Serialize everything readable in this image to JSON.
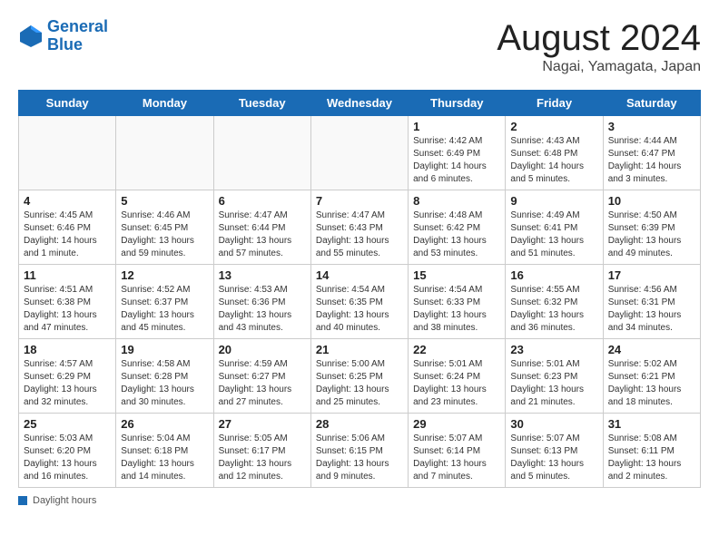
{
  "header": {
    "logo_line1": "General",
    "logo_line2": "Blue",
    "month": "August 2024",
    "location": "Nagai, Yamagata, Japan"
  },
  "weekdays": [
    "Sunday",
    "Monday",
    "Tuesday",
    "Wednesday",
    "Thursday",
    "Friday",
    "Saturday"
  ],
  "footer_label": "Daylight hours",
  "weeks": [
    [
      {
        "day": "",
        "sunrise": "",
        "sunset": "",
        "daylight": "",
        "empty": true
      },
      {
        "day": "",
        "sunrise": "",
        "sunset": "",
        "daylight": "",
        "empty": true
      },
      {
        "day": "",
        "sunrise": "",
        "sunset": "",
        "daylight": "",
        "empty": true
      },
      {
        "day": "",
        "sunrise": "",
        "sunset": "",
        "daylight": "",
        "empty": true
      },
      {
        "day": "1",
        "sunrise": "Sunrise: 4:42 AM",
        "sunset": "Sunset: 6:49 PM",
        "daylight": "Daylight: 14 hours and 6 minutes."
      },
      {
        "day": "2",
        "sunrise": "Sunrise: 4:43 AM",
        "sunset": "Sunset: 6:48 PM",
        "daylight": "Daylight: 14 hours and 5 minutes."
      },
      {
        "day": "3",
        "sunrise": "Sunrise: 4:44 AM",
        "sunset": "Sunset: 6:47 PM",
        "daylight": "Daylight: 14 hours and 3 minutes."
      }
    ],
    [
      {
        "day": "4",
        "sunrise": "Sunrise: 4:45 AM",
        "sunset": "Sunset: 6:46 PM",
        "daylight": "Daylight: 14 hours and 1 minute."
      },
      {
        "day": "5",
        "sunrise": "Sunrise: 4:46 AM",
        "sunset": "Sunset: 6:45 PM",
        "daylight": "Daylight: 13 hours and 59 minutes."
      },
      {
        "day": "6",
        "sunrise": "Sunrise: 4:47 AM",
        "sunset": "Sunset: 6:44 PM",
        "daylight": "Daylight: 13 hours and 57 minutes."
      },
      {
        "day": "7",
        "sunrise": "Sunrise: 4:47 AM",
        "sunset": "Sunset: 6:43 PM",
        "daylight": "Daylight: 13 hours and 55 minutes."
      },
      {
        "day": "8",
        "sunrise": "Sunrise: 4:48 AM",
        "sunset": "Sunset: 6:42 PM",
        "daylight": "Daylight: 13 hours and 53 minutes."
      },
      {
        "day": "9",
        "sunrise": "Sunrise: 4:49 AM",
        "sunset": "Sunset: 6:41 PM",
        "daylight": "Daylight: 13 hours and 51 minutes."
      },
      {
        "day": "10",
        "sunrise": "Sunrise: 4:50 AM",
        "sunset": "Sunset: 6:39 PM",
        "daylight": "Daylight: 13 hours and 49 minutes."
      }
    ],
    [
      {
        "day": "11",
        "sunrise": "Sunrise: 4:51 AM",
        "sunset": "Sunset: 6:38 PM",
        "daylight": "Daylight: 13 hours and 47 minutes."
      },
      {
        "day": "12",
        "sunrise": "Sunrise: 4:52 AM",
        "sunset": "Sunset: 6:37 PM",
        "daylight": "Daylight: 13 hours and 45 minutes."
      },
      {
        "day": "13",
        "sunrise": "Sunrise: 4:53 AM",
        "sunset": "Sunset: 6:36 PM",
        "daylight": "Daylight: 13 hours and 43 minutes."
      },
      {
        "day": "14",
        "sunrise": "Sunrise: 4:54 AM",
        "sunset": "Sunset: 6:35 PM",
        "daylight": "Daylight: 13 hours and 40 minutes."
      },
      {
        "day": "15",
        "sunrise": "Sunrise: 4:54 AM",
        "sunset": "Sunset: 6:33 PM",
        "daylight": "Daylight: 13 hours and 38 minutes."
      },
      {
        "day": "16",
        "sunrise": "Sunrise: 4:55 AM",
        "sunset": "Sunset: 6:32 PM",
        "daylight": "Daylight: 13 hours and 36 minutes."
      },
      {
        "day": "17",
        "sunrise": "Sunrise: 4:56 AM",
        "sunset": "Sunset: 6:31 PM",
        "daylight": "Daylight: 13 hours and 34 minutes."
      }
    ],
    [
      {
        "day": "18",
        "sunrise": "Sunrise: 4:57 AM",
        "sunset": "Sunset: 6:29 PM",
        "daylight": "Daylight: 13 hours and 32 minutes."
      },
      {
        "day": "19",
        "sunrise": "Sunrise: 4:58 AM",
        "sunset": "Sunset: 6:28 PM",
        "daylight": "Daylight: 13 hours and 30 minutes."
      },
      {
        "day": "20",
        "sunrise": "Sunrise: 4:59 AM",
        "sunset": "Sunset: 6:27 PM",
        "daylight": "Daylight: 13 hours and 27 minutes."
      },
      {
        "day": "21",
        "sunrise": "Sunrise: 5:00 AM",
        "sunset": "Sunset: 6:25 PM",
        "daylight": "Daylight: 13 hours and 25 minutes."
      },
      {
        "day": "22",
        "sunrise": "Sunrise: 5:01 AM",
        "sunset": "Sunset: 6:24 PM",
        "daylight": "Daylight: 13 hours and 23 minutes."
      },
      {
        "day": "23",
        "sunrise": "Sunrise: 5:01 AM",
        "sunset": "Sunset: 6:23 PM",
        "daylight": "Daylight: 13 hours and 21 minutes."
      },
      {
        "day": "24",
        "sunrise": "Sunrise: 5:02 AM",
        "sunset": "Sunset: 6:21 PM",
        "daylight": "Daylight: 13 hours and 18 minutes."
      }
    ],
    [
      {
        "day": "25",
        "sunrise": "Sunrise: 5:03 AM",
        "sunset": "Sunset: 6:20 PM",
        "daylight": "Daylight: 13 hours and 16 minutes."
      },
      {
        "day": "26",
        "sunrise": "Sunrise: 5:04 AM",
        "sunset": "Sunset: 6:18 PM",
        "daylight": "Daylight: 13 hours and 14 minutes."
      },
      {
        "day": "27",
        "sunrise": "Sunrise: 5:05 AM",
        "sunset": "Sunset: 6:17 PM",
        "daylight": "Daylight: 13 hours and 12 minutes."
      },
      {
        "day": "28",
        "sunrise": "Sunrise: 5:06 AM",
        "sunset": "Sunset: 6:15 PM",
        "daylight": "Daylight: 13 hours and 9 minutes."
      },
      {
        "day": "29",
        "sunrise": "Sunrise: 5:07 AM",
        "sunset": "Sunset: 6:14 PM",
        "daylight": "Daylight: 13 hours and 7 minutes."
      },
      {
        "day": "30",
        "sunrise": "Sunrise: 5:07 AM",
        "sunset": "Sunset: 6:13 PM",
        "daylight": "Daylight: 13 hours and 5 minutes."
      },
      {
        "day": "31",
        "sunrise": "Sunrise: 5:08 AM",
        "sunset": "Sunset: 6:11 PM",
        "daylight": "Daylight: 13 hours and 2 minutes."
      }
    ]
  ]
}
